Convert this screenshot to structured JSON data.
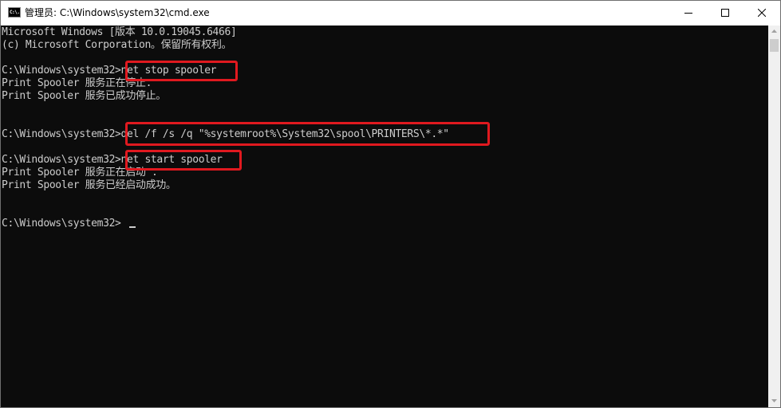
{
  "window": {
    "title": "管理员: C:\\Windows\\system32\\cmd.exe",
    "icon": "cmd-icon",
    "icon_text": "C:\\.",
    "controls": [
      "minimize-icon",
      "maximize-icon",
      "close-icon"
    ]
  },
  "console": {
    "lines": [
      "Microsoft Windows [版本 10.0.19045.6466]",
      "(c) Microsoft Corporation。保留所有权利。",
      "",
      "C:\\Windows\\system32>net stop spooler",
      "Print Spooler 服务正在停止.",
      "Print Spooler 服务已成功停止。",
      "",
      "",
      "C:\\Windows\\system32>del /f /s /q \"%systemroot%\\System32\\spool\\PRINTERS\\*.*\"",
      "",
      "C:\\Windows\\system32>net start spooler",
      "Print Spooler 服务正在启动 .",
      "Print Spooler 服务已经启动成功。",
      "",
      "",
      "C:\\Windows\\system32>"
    ],
    "highlighted_commands": [
      "net stop spooler",
      "del /f /s /q \"%systemroot%\\System32\\spool\\PRINTERS\\*.*\"",
      "net start spooler"
    ]
  },
  "colors": {
    "console_bg": "#0c0c0c",
    "console_text": "#cccccc",
    "highlight": "#e0191f",
    "titlebar_bg": "#ffffff"
  }
}
